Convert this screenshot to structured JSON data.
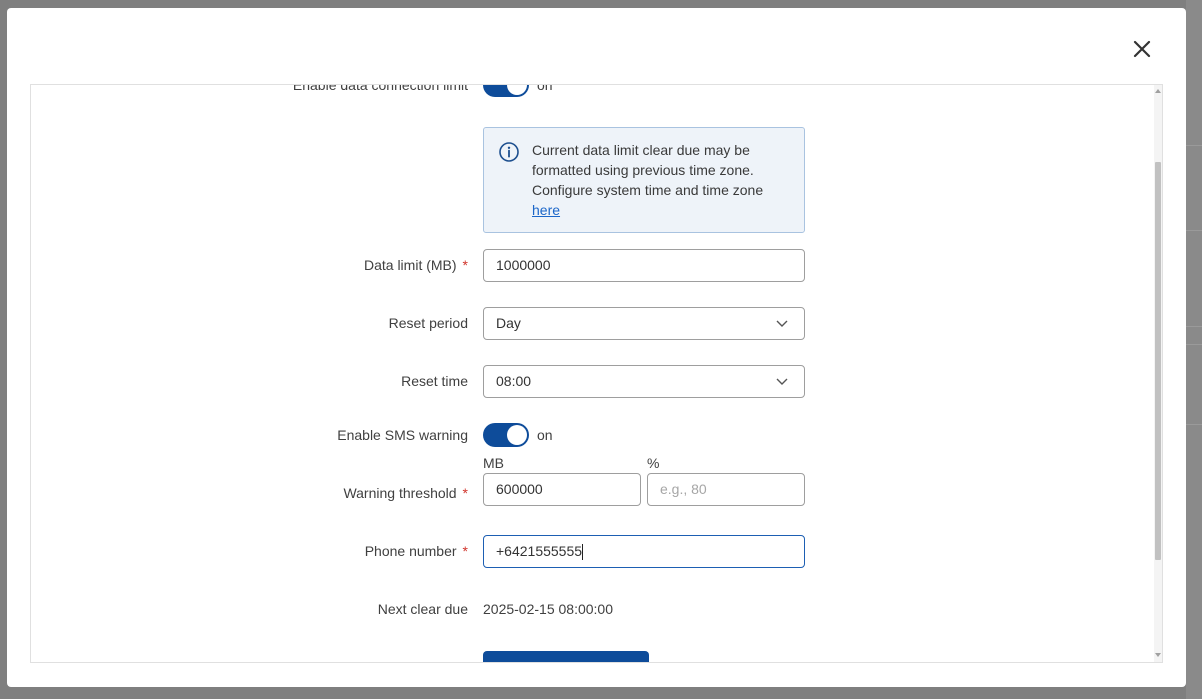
{
  "modal": {
    "close_icon": "close-icon",
    "fields": {
      "enable_data_limit": {
        "label": "Enable data connection limit",
        "state": "on"
      },
      "info": {
        "icon": "info-icon",
        "text": "Current data limit clear due may be formatted using previous time zone. Configure system time and time zone",
        "link": "here"
      },
      "data_limit": {
        "label": "Data limit (MB)",
        "required": "*",
        "value": "1000000"
      },
      "reset_period": {
        "label": "Reset period",
        "value": "Day"
      },
      "reset_time": {
        "label": "Reset time",
        "value": "08:00"
      },
      "enable_sms_warning": {
        "label": "Enable SMS warning",
        "state": "on"
      },
      "warning_threshold": {
        "label": "Warning threshold",
        "required": "*",
        "mb_label": "MB",
        "mb_value": "600000",
        "percent_label": "%",
        "percent_placeholder": "e.g., 80"
      },
      "phone_number": {
        "label": "Phone number",
        "required": "*",
        "value": "+6421555555"
      },
      "next_clear_due": {
        "label": "Next clear due",
        "value": "2025-02-15 08:00:00"
      }
    }
  },
  "colors": {
    "accent": "#0e4c9a",
    "required": "#d0332a",
    "link": "#1b66c9",
    "info_bg": "#eef3f9"
  }
}
